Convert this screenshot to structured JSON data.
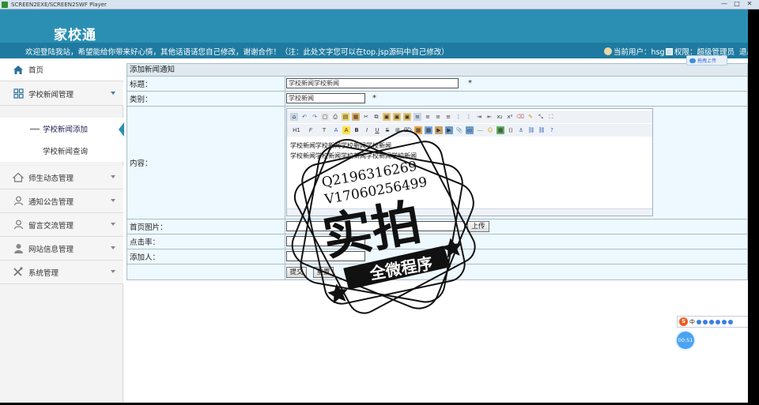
{
  "window": {
    "title": "SCREEN2EXE/SCREEN2SWF Player",
    "controls": [
      "—",
      "□",
      "✕"
    ]
  },
  "header": {
    "brand": "家校通",
    "welcome": "欢迎登陆我站，希望能给你带来好心情，其他话语请您自己修改，谢谢合作！（注：此处文字您可以在top.jsp源码中自己修改）",
    "current_user": "当前用户：hsg",
    "permission": "权限：超级管理员",
    "logout": "退出",
    "upload_chip": "拖拽上传"
  },
  "sidebar": {
    "home": "首页",
    "groups": [
      {
        "label": "学校新闻管理",
        "open": true
      },
      {
        "label": "师生动态管理",
        "open": false
      },
      {
        "label": "通知公告管理",
        "open": false
      },
      {
        "label": "留言交流管理",
        "open": false
      },
      {
        "label": "网站信息管理",
        "open": false
      },
      {
        "label": "系统管理",
        "open": false
      }
    ],
    "submenu": [
      {
        "label": "学校新闻添加",
        "active": true
      },
      {
        "label": "学校新闻查询",
        "active": false
      }
    ]
  },
  "form": {
    "panel_title": "添加新闻通知",
    "title_label": "标题：",
    "title_value": "学校新闻学校新闻",
    "category_label": "类别：",
    "category_value": "学校新闻",
    "required_mark": "*",
    "content_label": "内容：",
    "content_lines": [
      "学校新闻学校新闻学校新闻学校新闻",
      "学校新闻学校新闻学校新闻学校新闻学校新闻"
    ],
    "image_label": "首页图片：",
    "image_value": "",
    "upload_button": "上传",
    "clicks_label": "点击率：",
    "clicks_value": "",
    "author_label": "添加人：",
    "author_value": "",
    "submit_button": "提交",
    "reset_button": "重置"
  },
  "watermark": {
    "qq": "Q2196316269",
    "vx": "V17060256499",
    "big": "实拍",
    "banner": "全微程序"
  },
  "ime": {
    "label": "中"
  },
  "timer": "00:51"
}
